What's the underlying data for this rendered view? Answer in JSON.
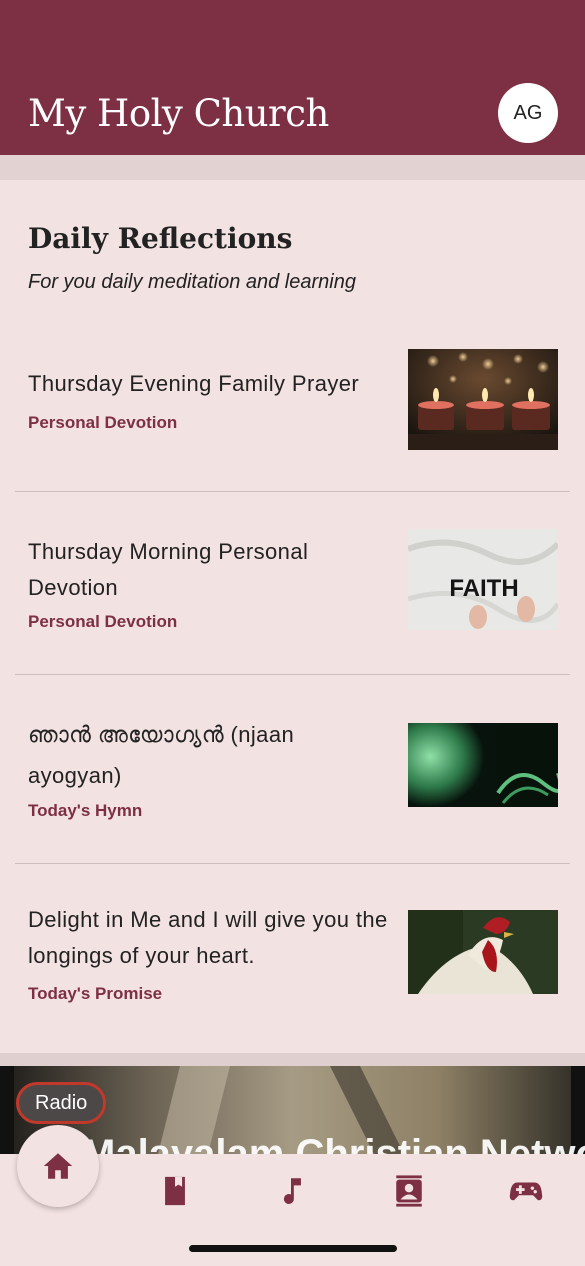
{
  "header": {
    "title": "My Holy Church",
    "avatar_initials": "AG"
  },
  "section": {
    "title": "Daily Reflections",
    "subtitle": "For you daily meditation and learning"
  },
  "items": [
    {
      "title": "Thursday Evening Family Prayer",
      "category": "Personal Devotion",
      "thumb": "candles-image"
    },
    {
      "title": "Thursday Morning Personal Devotion",
      "category": "Personal Devotion",
      "thumb": "faith-shirt-image",
      "thumb_text": "FAITH"
    },
    {
      "title": "ഞാൻ അയോഗ്യൻ (njaan ayogyan)",
      "category": "Today's Hymn",
      "thumb": "green-smoke-image"
    },
    {
      "title": "Delight in Me and I will give you the longings of your heart.",
      "category": "Today's Promise",
      "thumb": "rooster-image"
    }
  ],
  "radio": {
    "label": "Radio",
    "banner_text": "Malayalam Christian Network"
  },
  "nav": {
    "items": [
      "home-icon",
      "book-icon",
      "music-note-icon",
      "contacts-icon",
      "gamepad-icon"
    ]
  },
  "colors": {
    "brand": "#7d3043",
    "background": "#f3e2e2"
  }
}
